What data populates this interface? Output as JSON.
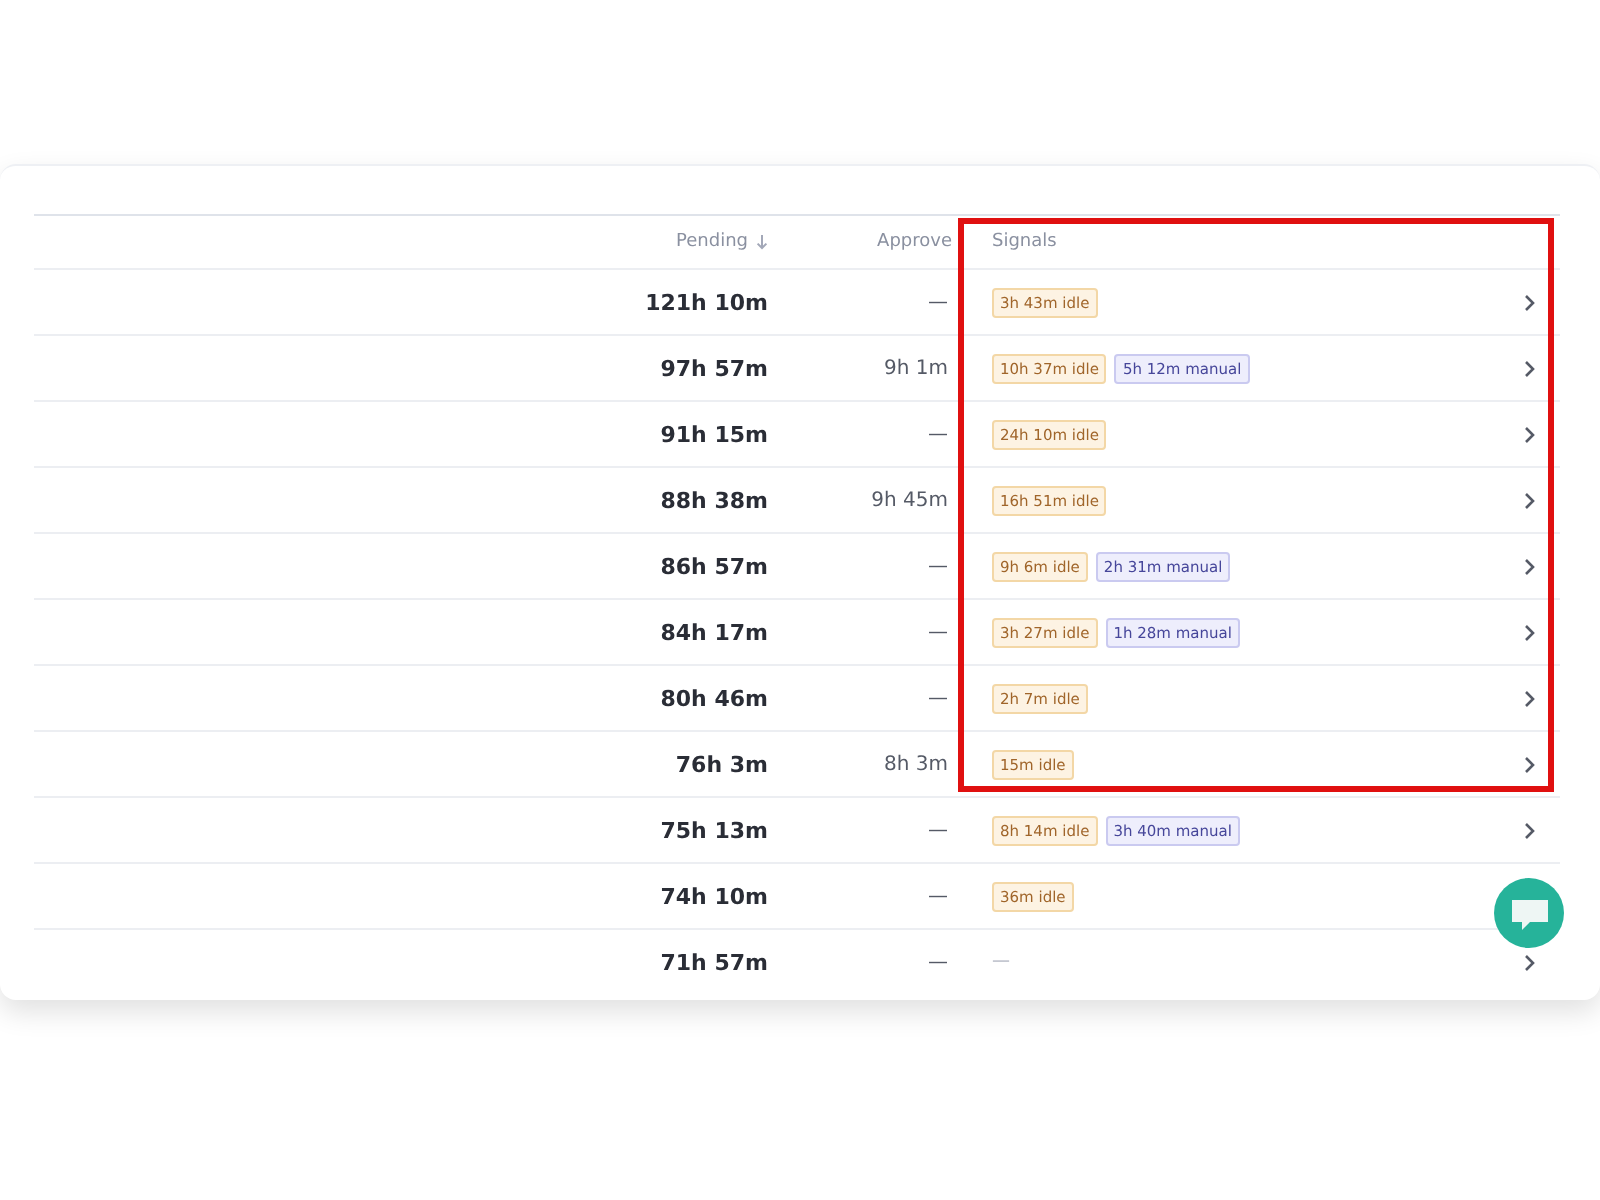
{
  "table": {
    "columns": [
      {
        "label": "Pending",
        "sorted": true
      },
      {
        "label": "Approve",
        "sorted": false
      },
      {
        "label": "Signals",
        "sorted": false
      }
    ],
    "rows": [
      {
        "pending": "121h 10m",
        "approved": "—",
        "signals": [
          {
            "kind": "idle",
            "text": "3h 43m idle"
          }
        ]
      },
      {
        "pending": "97h 57m",
        "approved": "9h 1m",
        "signals": [
          {
            "kind": "idle",
            "text": "10h 37m idle"
          },
          {
            "kind": "manual",
            "text": "5h 12m manual"
          }
        ]
      },
      {
        "pending": "91h 15m",
        "approved": "—",
        "signals": [
          {
            "kind": "idle",
            "text": "24h 10m idle"
          }
        ]
      },
      {
        "pending": "88h 38m",
        "approved": "9h 45m",
        "signals": [
          {
            "kind": "idle",
            "text": "16h 51m idle"
          }
        ]
      },
      {
        "pending": "86h 57m",
        "approved": "—",
        "signals": [
          {
            "kind": "idle",
            "text": "9h 6m idle"
          },
          {
            "kind": "manual",
            "text": "2h 31m manual"
          }
        ]
      },
      {
        "pending": "84h 17m",
        "approved": "—",
        "signals": [
          {
            "kind": "idle",
            "text": "3h 27m idle"
          },
          {
            "kind": "manual",
            "text": "1h 28m manual"
          }
        ]
      },
      {
        "pending": "80h 46m",
        "approved": "—",
        "signals": [
          {
            "kind": "idle",
            "text": "2h 7m idle"
          }
        ]
      },
      {
        "pending": "76h 3m",
        "approved": "8h 3m",
        "signals": [
          {
            "kind": "idle",
            "text": "15m idle"
          }
        ]
      },
      {
        "pending": "75h 13m",
        "approved": "—",
        "signals": [
          {
            "kind": "idle",
            "text": "8h 14m idle"
          },
          {
            "kind": "manual",
            "text": "3h 40m manual"
          }
        ]
      },
      {
        "pending": "74h 10m",
        "approved": "—",
        "signals": [
          {
            "kind": "idle",
            "text": "36m idle"
          }
        ]
      },
      {
        "pending": "71h 57m",
        "approved": "—",
        "signals": [
          {
            "kind": "none",
            "text": "—"
          }
        ]
      }
    ]
  }
}
